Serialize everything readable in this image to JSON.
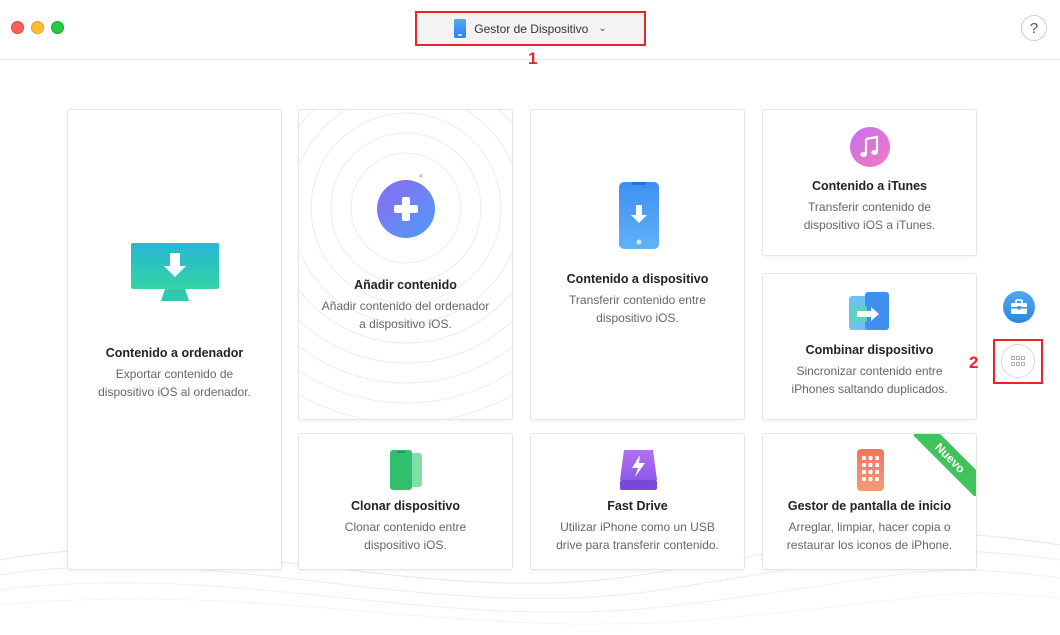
{
  "header": {
    "device_menu_label": "Gestor de Dispositivo",
    "help_label": "?",
    "callout_1": "1",
    "callout_2": "2"
  },
  "cards": {
    "ordenador": {
      "title": "Contenido a ordenador",
      "desc_1": "Exportar contenido de",
      "desc_2": "dispositivo iOS al ordenador."
    },
    "anadir": {
      "title": "Añadir contenido",
      "desc_1": "Añadir contenido del ordenador",
      "desc_2": "a dispositivo iOS."
    },
    "dispositivo": {
      "title": "Contenido a dispositivo",
      "desc_1": "Transferir contenido entre",
      "desc_2": "dispositivo iOS."
    },
    "itunes": {
      "title": "Contenido a iTunes",
      "desc_1": "Transferir contenido de",
      "desc_2": "dispositivo iOS a iTunes."
    },
    "combinar": {
      "title": "Combinar dispositivo",
      "desc_1": "Sincronizar contenido entre",
      "desc_2": "iPhones saltando duplicados."
    },
    "clonar": {
      "title": "Clonar dispositivo",
      "desc_1": "Clonar contenido entre",
      "desc_2": "dispositivo iOS."
    },
    "fastdrive": {
      "title": "Fast Drive",
      "desc_1": "Utilizar iPhone como un USB",
      "desc_2": "drive para transferir contenido."
    },
    "gestor": {
      "title": "Gestor de pantalla de inicio",
      "desc_1": "Arreglar, limpiar, hacer copia o",
      "desc_2": "restaurar los iconos de iPhone.",
      "badge": "Nuevo"
    }
  },
  "icons": {
    "device_menu": "phone-icon",
    "ordenador": "monitor-download-icon",
    "anadir": "plus-circle-icon",
    "dispositivo": "phone-download-icon",
    "itunes": "music-note-icon",
    "combinar": "merge-phones-icon",
    "clonar": "clone-phones-icon",
    "fastdrive": "drive-bolt-icon",
    "gestor": "home-screen-icon",
    "toolbox": "toolbox-icon",
    "more": "grid-dots-icon"
  },
  "colors": {
    "accent_blue": "#2f80ed",
    "highlight_red": "#e8262a",
    "ribbon_green": "#42c25a"
  }
}
